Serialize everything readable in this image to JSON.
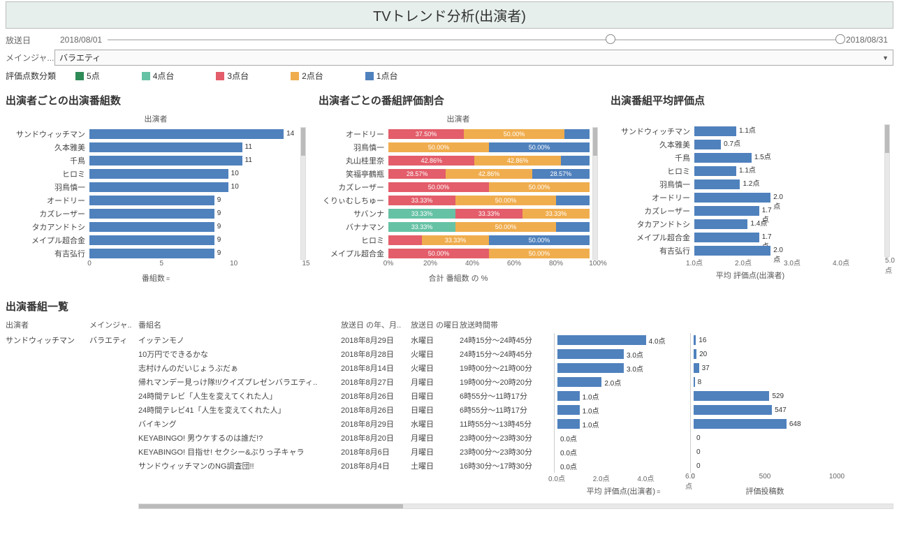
{
  "title": "TVトレンド分析(出演者)",
  "filters": {
    "broadcast_date_label": "放送日",
    "date_start": "2018/08/01",
    "date_end": "2018/08/31",
    "genre_label": "メインジャ...",
    "genre_value": "バラエティ"
  },
  "legend": {
    "label": "評価点数分類",
    "items": [
      {
        "name": "5点",
        "color": "#2e8b57"
      },
      {
        "name": "4点台",
        "color": "#66c2a5"
      },
      {
        "name": "3点台",
        "color": "#e35d6a"
      },
      {
        "name": "2点台",
        "color": "#f0ad4e"
      },
      {
        "name": "1点台",
        "color": "#4f81bd"
      }
    ]
  },
  "chart_data": [
    {
      "id": "chart1",
      "type": "bar",
      "orientation": "horizontal",
      "title": "出演者ごとの出演番組数",
      "ylabel": "出演者",
      "xlabel": "番組数",
      "xlim": [
        0,
        15
      ],
      "xticks": [
        0,
        5,
        10,
        15
      ],
      "categories": [
        "サンドウィッチマン",
        "久本雅美",
        "千鳥",
        "ヒロミ",
        "羽鳥慎一",
        "オードリー",
        "カズレーザー",
        "タカアンドトシ",
        "メイプル超合金",
        "有吉弘行"
      ],
      "values": [
        14,
        11,
        11,
        10,
        10,
        9,
        9,
        9,
        9,
        9
      ],
      "sorted": "desc"
    },
    {
      "id": "chart2",
      "type": "stacked_bar_percent",
      "orientation": "horizontal",
      "title": "出演者ごとの番組評価割合",
      "ylabel": "出演者",
      "xlabel": "合計 番組数 の %",
      "xlim": [
        0,
        100
      ],
      "xticks": [
        0,
        20,
        40,
        60,
        80,
        100
      ],
      "categories": [
        "オードリー",
        "羽鳥慎一",
        "丸山桂里奈",
        "笑福亭鶴瓶",
        "カズレーザー",
        "くりぃむしちゅー",
        "サバンナ",
        "バナナマン",
        "ヒロミ",
        "メイプル超合金"
      ],
      "stack_order": [
        "5点",
        "4点台",
        "3点台",
        "2点台",
        "1点台"
      ],
      "series": [
        {
          "5": 0,
          "4": 0,
          "3": 37.5,
          "2": 50.0,
          "1": 12.5
        },
        {
          "5": 0,
          "4": 0,
          "3": 0,
          "2": 50.0,
          "1": 50.0
        },
        {
          "5": 0,
          "4": 0,
          "3": 42.86,
          "2": 42.86,
          "1": 14.28
        },
        {
          "5": 0,
          "4": 0,
          "3": 28.57,
          "2": 42.86,
          "1": 28.57
        },
        {
          "5": 0,
          "4": 0,
          "3": 50.0,
          "2": 50.0,
          "1": 0
        },
        {
          "5": 0,
          "4": 0,
          "3": 33.33,
          "2": 50.0,
          "1": 16.67
        },
        {
          "5": 0,
          "4": 33.33,
          "3": 33.33,
          "2": 33.33,
          "1": 0
        },
        {
          "5": 0,
          "4": 33.33,
          "3": 0,
          "2": 50.0,
          "1": 16.67
        },
        {
          "5": 0,
          "4": 0,
          "3": 16.67,
          "2": 33.33,
          "1": 50.0
        },
        {
          "5": 0,
          "4": 0,
          "3": 50.0,
          "2": 50.0,
          "1": 0
        }
      ]
    },
    {
      "id": "chart3",
      "type": "bar",
      "orientation": "horizontal",
      "title": "出演番組平均評価点",
      "ylabel": "",
      "xlabel": "平均 評価点(出演者)",
      "xlim": [
        1.0,
        5.0
      ],
      "xticks": [
        1.0,
        2.0,
        3.0,
        4.0,
        5.0
      ],
      "unit": "点",
      "categories": [
        "サンドウィッチマン",
        "久本雅美",
        "千鳥",
        "ヒロミ",
        "羽鳥慎一",
        "オードリー",
        "カズレーザー",
        "タカアンドトシ",
        "メイプル超合金",
        "有吉弘行"
      ],
      "values": [
        1.1,
        0.7,
        1.5,
        1.1,
        1.2,
        2.0,
        1.7,
        1.4,
        1.7,
        2.0
      ]
    }
  ],
  "table": {
    "title": "出演番組一覧",
    "columns": [
      "出演者",
      "メインジャ..",
      "番組名",
      "放送日 の年、月..",
      "放送日 の曜日",
      "放送時間帯"
    ],
    "rating_axis": {
      "label": "平均 評価点(出演者)",
      "ticks": [
        0.0,
        2.0,
        4.0,
        6.0
      ],
      "unit": "点",
      "max": 6.0,
      "sorted": "desc"
    },
    "posts_axis": {
      "label": "評価投稿数",
      "ticks": [
        0,
        500,
        1000
      ],
      "max": 1000
    },
    "group_performer": "サンドウィッチマン",
    "group_genre": "バラエティ",
    "rows": [
      {
        "program": "イッテンモノ",
        "date": "2018年8月29日",
        "dow": "水曜日",
        "time": "24時15分～24時45分",
        "rating": 4.0,
        "posts": 16
      },
      {
        "program": "10万円でできるかな",
        "date": "2018年8月28日",
        "dow": "火曜日",
        "time": "24時15分～24時45分",
        "rating": 3.0,
        "posts": 20
      },
      {
        "program": "志村けんのだいじょうぶだぁ",
        "date": "2018年8月14日",
        "dow": "火曜日",
        "time": "19時00分～21時00分",
        "rating": 3.0,
        "posts": 37
      },
      {
        "program": "帰れマンデー見っけ隊!!/クイズプレゼンバラエティ..",
        "date": "2018年8月27日",
        "dow": "月曜日",
        "time": "19時00分～20時20分",
        "rating": 2.0,
        "posts": 8
      },
      {
        "program": "24時間テレビ「人生を変えてくれた人」",
        "date": "2018年8月26日",
        "dow": "日曜日",
        "time": "6時55分～11時17分",
        "rating": 1.0,
        "posts": 529
      },
      {
        "program": "24時間テレビ41「人生を変えてくれた人」",
        "date": "2018年8月26日",
        "dow": "日曜日",
        "time": "6時55分～11時17分",
        "rating": 1.0,
        "posts": 547
      },
      {
        "program": "バイキング",
        "date": "2018年8月29日",
        "dow": "水曜日",
        "time": "11時55分～13時45分",
        "rating": 1.0,
        "posts": 648
      },
      {
        "program": "KEYABINGO! 男ウケするのは誰だ!?",
        "date": "2018年8月20日",
        "dow": "月曜日",
        "time": "23時00分～23時30分",
        "rating": 0.0,
        "posts": 0
      },
      {
        "program": "KEYABINGO! 目指せ! セクシー&ぶりっ子キャラ",
        "date": "2018年8月6日",
        "dow": "月曜日",
        "time": "23時00分～23時30分",
        "rating": 0.0,
        "posts": 0
      },
      {
        "program": "サンドウィッチマンのNG調査団!!",
        "date": "2018年8月4日",
        "dow": "土曜日",
        "time": "16時30分～17時30分",
        "rating": 0.0,
        "posts": 0
      }
    ]
  }
}
